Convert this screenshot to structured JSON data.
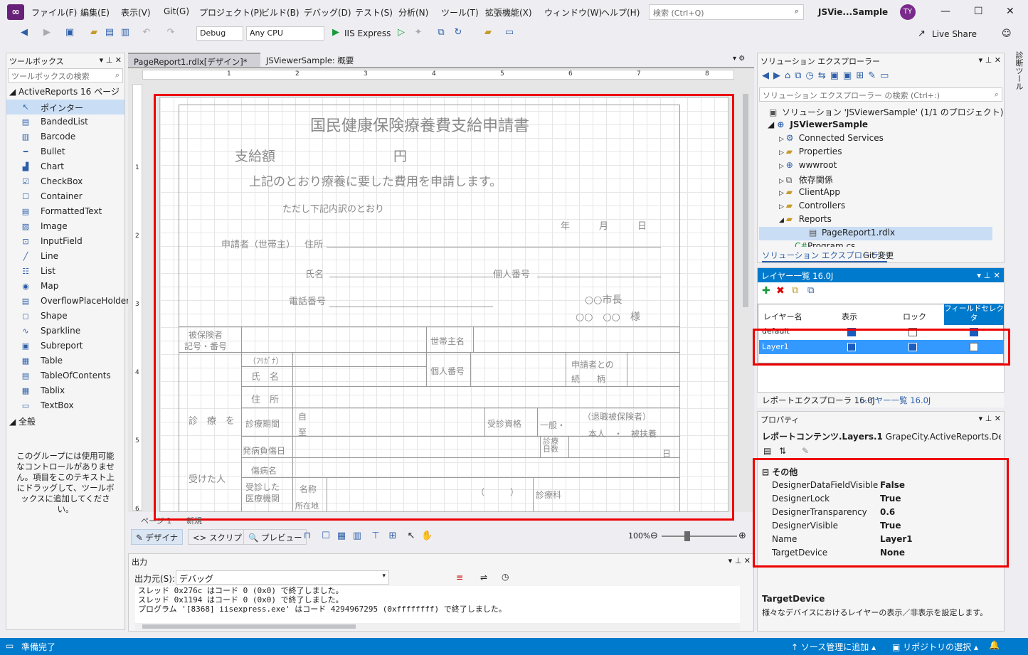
{
  "window": {
    "title": "JSVie...Sample",
    "user_initials": "TY",
    "search_placeholder": "検索 (Ctrl+Q)"
  },
  "menu": [
    "ファイル(F)",
    "編集(E)",
    "表示(V)",
    "Git(G)",
    "プロジェクト(P)",
    "ビルド(B)",
    "デバッグ(D)",
    "テスト(S)",
    "分析(N)",
    "ツール(T)",
    "拡張機能(X)",
    "ウィンドウ(W)",
    "ヘルプ(H)"
  ],
  "toolbar": {
    "config": "Debug",
    "platform": "Any CPU",
    "run_label": "IIS Express",
    "live_share": "Live Share"
  },
  "toolbox": {
    "title": "ツールボックス",
    "search_placeholder": "ツールボックスの検索",
    "group": "ActiveReports 16 ページ",
    "items": [
      "ポインター",
      "BandedList",
      "Barcode",
      "Bullet",
      "Chart",
      "CheckBox",
      "Container",
      "FormattedText",
      "Image",
      "InputField",
      "Line",
      "List",
      "Map",
      "OverflowPlaceHolder",
      "Shape",
      "Sparkline",
      "Subreport",
      "Table",
      "TableOfContents",
      "Tablix",
      "TextBox"
    ],
    "group2": "全般",
    "note": "このグループには使用可能なコントロールがありません。項目をこのテキスト上にドラッグして、ツールボックスに追加してください。"
  },
  "editor": {
    "tabs": [
      "PageReport1.rdlx[デザイン]*",
      "JSViewerSample: 概要"
    ],
    "ruler_marks": [
      "1",
      "2",
      "3",
      "4",
      "5",
      "6",
      "7",
      "8"
    ],
    "vruler_marks": [
      "1",
      "2",
      "3",
      "4",
      "5",
      "6"
    ],
    "page_tabs": [
      "ページ 1",
      "新規"
    ],
    "zoom": "100%",
    "design_buttons": [
      "デザイナ",
      "スクリプト",
      "プレビュー"
    ]
  },
  "form": {
    "title": "国民健康保険療養費支給申請書",
    "amount_label": "支給額",
    "yen": "円",
    "request": "上記のとおり療養に要した費用を申請します。",
    "breakdown": "ただし下記内訳のとおり",
    "date": [
      "年",
      "月",
      "日"
    ],
    "applicant": "申請者（世帯主）",
    "address": "住所",
    "name": "氏名",
    "personal_no": "個人番号",
    "phone": "電話番号",
    "mayor": "○○市長",
    "mayor2": "○○　○○　様",
    "insured": "被保険者\n記号・番号",
    "householder": "世帯主名",
    "furigana": "（ﾌﾘｶﾞﾅ）",
    "shimei": "氏　名",
    "kojin": "個人番号",
    "relation": "申請者との\n続　　柄",
    "jusho": "住　所",
    "shinryo": "診　療　を",
    "period": "診療期間",
    "from": "自",
    "to": "至",
    "qualification": "受診資格",
    "general": "一般・",
    "retired": "（退職被保険者）",
    "self_dep": "本人　・　被扶養",
    "onset": "発病負傷日",
    "days": "診療\n日数",
    "nichi": "日",
    "received": "受けた人",
    "disease": "傷病名",
    "institution": "受診した\n医療機関",
    "inst_name": "名称",
    "inst_loc": "所在地",
    "paren": "（　　　）",
    "dept": "診療科"
  },
  "output": {
    "title": "出力",
    "source_label": "出力元(S):",
    "source": "デバッグ",
    "lines": [
      "スレッド 0x276c はコード 0 (0x0) で終了しました。",
      "スレッド 0x1194 はコード 0 (0x0) で終了しました。",
      "プログラム '[8368] iisexpress.exe' はコード 4294967295 (0xffffffff) で終了しました。"
    ]
  },
  "solution_explorer": {
    "title": "ソリューション エクスプローラー",
    "search_placeholder": "ソリューション エクスプローラー の検索 (Ctrl+:)",
    "solution": "ソリューション 'JSViewerSample' (1/1 のプロジェクト)",
    "project": "JSViewerSample",
    "nodes": [
      "Connected Services",
      "Properties",
      "wwwroot",
      "依存関係",
      "ClientApp",
      "Controllers",
      "Reports"
    ],
    "selected": "PageReport1.rdlx",
    "last": "Program.cs",
    "bottom_tabs": [
      "ソリューション エクスプローラー",
      "Git 変更"
    ]
  },
  "layers": {
    "title": "レイヤー一覧 16.0J",
    "columns": [
      "レイヤー名",
      "表示",
      "ロック",
      "フィールドセレクタ"
    ],
    "rows": [
      {
        "name": "default",
        "visible": true,
        "lock": false,
        "field": true
      },
      {
        "name": "Layer1",
        "visible": true,
        "lock": true,
        "field": false
      }
    ],
    "bottom_tabs": [
      "レポートエクスプローラ 16.0J",
      "レイヤー一覧 16.0J"
    ]
  },
  "properties": {
    "title": "プロパティ",
    "object": "レポートコンテンツ.Layers.1",
    "object_type": "GrapeCity.ActiveReports.Design.DdrD",
    "category": "その他",
    "rows": [
      {
        "name": "DesignerDataFieldVisible",
        "value": "False"
      },
      {
        "name": "DesignerLock",
        "value": "True"
      },
      {
        "name": "DesignerTransparency",
        "value": "0.6"
      },
      {
        "name": "DesignerVisible",
        "value": "True"
      },
      {
        "name": "Name",
        "value": "Layer1"
      },
      {
        "name": "TargetDevice",
        "value": "None"
      }
    ],
    "desc_title": "TargetDevice",
    "desc": "様々なデバイスにおけるレイヤーの表示／非表示を設定します。"
  },
  "status": {
    "left": "準備完了",
    "source_control": "ソース管理に追加",
    "repo": "リポジトリの選択"
  },
  "side_tab": "診断ツール"
}
